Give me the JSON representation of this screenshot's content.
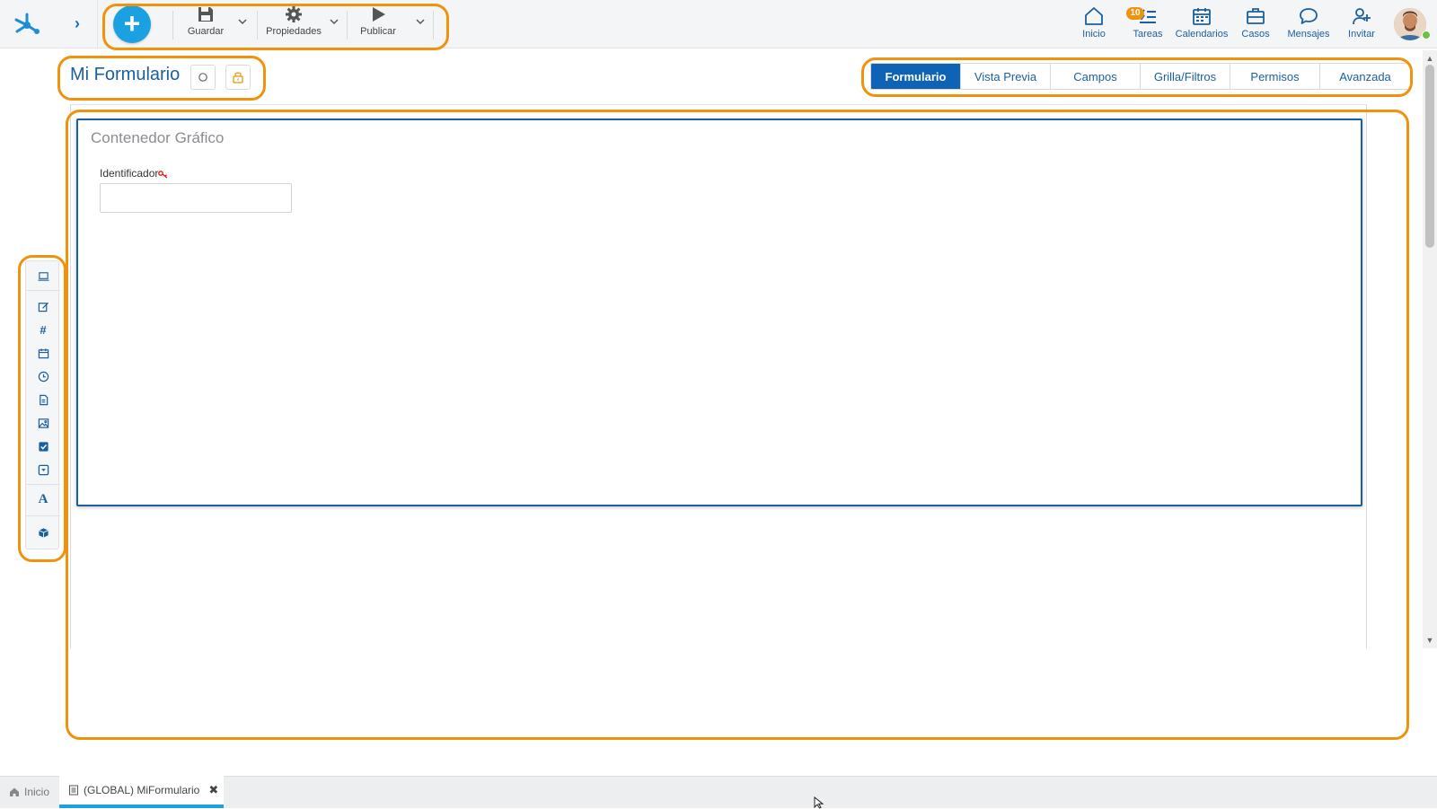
{
  "toolbar": {
    "add_label": "+",
    "save_label": "Guardar",
    "properties_label": "Propiedades",
    "publish_label": "Publicar"
  },
  "nav": {
    "home_label": "Inicio",
    "tasks_label": "Tareas",
    "tasks_badge": "10",
    "calendars_label": "Calendarios",
    "cases_label": "Casos",
    "messages_label": "Mensajes",
    "invite_label": "Invitar"
  },
  "form": {
    "title": "Mi Formulario",
    "container_title": "Contenedor Gráfico",
    "field_label": "Identificador"
  },
  "tabs": [
    {
      "label": "Formulario",
      "active": true
    },
    {
      "label": "Vista Previa",
      "active": false
    },
    {
      "label": "Campos",
      "active": false
    },
    {
      "label": "Grilla/Filtros",
      "active": false
    },
    {
      "label": "Permisos",
      "active": false
    },
    {
      "label": "Avanzada",
      "active": false
    }
  ],
  "palette": {
    "hash_symbol": "#",
    "text_symbol": "A"
  },
  "bottom_tabs": [
    {
      "label": "Inicio"
    },
    {
      "label": "(GLOBAL) MiFormulario"
    }
  ],
  "colors": {
    "accent": "#1ba1e2",
    "primary": "#0e63b4",
    "highlight": "#f0920c"
  }
}
